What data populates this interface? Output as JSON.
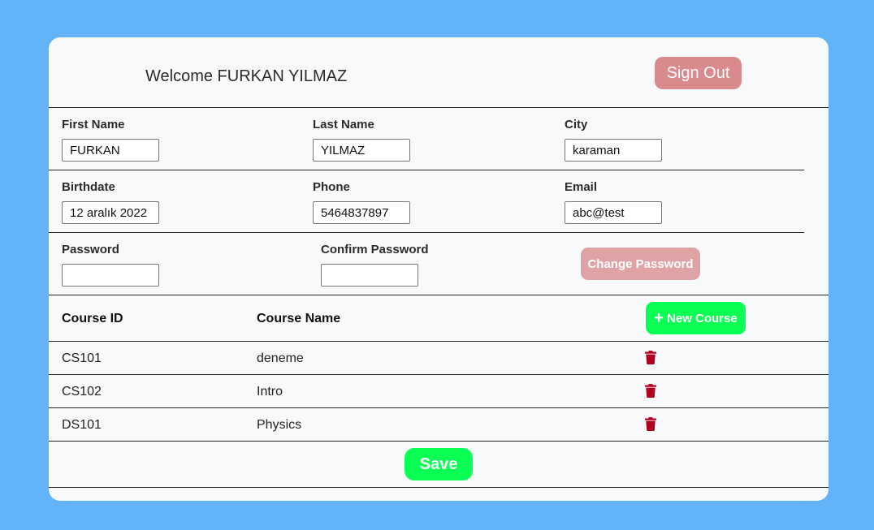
{
  "header": {
    "welcome": "Welcome FURKAN YILMAZ",
    "sign_out": "Sign Out"
  },
  "profile": {
    "first_name": {
      "label": "First Name",
      "value": "FURKAN"
    },
    "last_name": {
      "label": "Last Name",
      "value": "YILMAZ"
    },
    "city": {
      "label": "City",
      "value": "karaman"
    },
    "birthdate": {
      "label": "Birthdate",
      "value": "12 aralık 2022"
    },
    "phone": {
      "label": "Phone",
      "value": "5464837897"
    },
    "email": {
      "label": "Email",
      "value": "abc@test"
    },
    "password": {
      "label": "Password",
      "value": ""
    },
    "confirm_password": {
      "label": "Confirm Password",
      "value": ""
    },
    "change_password": "Change Password"
  },
  "courses": {
    "headers": {
      "id": "Course ID",
      "name": "Course Name"
    },
    "new_course": "New Course",
    "rows": [
      {
        "id": "CS101",
        "name": "deneme"
      },
      {
        "id": "CS102",
        "name": "Intro"
      },
      {
        "id": "DS101",
        "name": "Physics"
      }
    ]
  },
  "footer": {
    "save": "Save"
  },
  "colors": {
    "background": "#62b3f8",
    "card": "#f8f9fa",
    "sign_out": "#d98a8d",
    "change_password": "#e0a3a5",
    "success": "#0aff55",
    "danger": "#b00020"
  },
  "icons": {
    "add": "plus-icon",
    "delete": "trash-icon"
  }
}
